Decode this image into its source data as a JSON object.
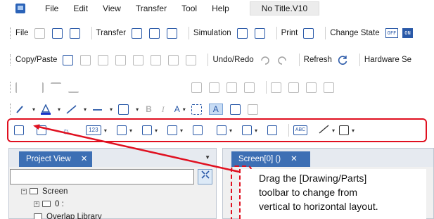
{
  "menubar": {
    "items": [
      "File",
      "Edit",
      "View",
      "Transfer",
      "Tool",
      "Help"
    ],
    "doc_title": "No Title.V10"
  },
  "toolbar1": {
    "file_label": "File",
    "transfer_label": "Transfer",
    "simulation_label": "Simulation",
    "print_label": "Print",
    "change_state_label": "Change State",
    "off_label": "OFF",
    "on_label": "ON"
  },
  "toolbar2": {
    "copy_paste_label": "Copy/Paste",
    "undo_redo_label": "Undo/Redo",
    "refresh_label": "Refresh",
    "hardware_label": "Hardware Se"
  },
  "toolbar4": {
    "bold_label": "B",
    "italic_label": "I",
    "font_label": "A",
    "a_label": "A"
  },
  "drawing_toolbar": {
    "num_label": "123",
    "abc_label": "ABC"
  },
  "project_view": {
    "tab_label": "Project View",
    "close": "✕",
    "tree": [
      {
        "label": "Screen"
      },
      {
        "label": "0 :"
      },
      {
        "label": "Overlap Library"
      }
    ]
  },
  "screen_panel": {
    "tab_label": "Screen[0] ()",
    "close": "✕"
  },
  "callout": {
    "lines": [
      "Drag the [Drawing/Parts]",
      "toolbar to change from",
      "vertical to horizontal layout."
    ]
  },
  "colors": {
    "accent": "#3d6fb4",
    "highlight": "#e01020"
  }
}
